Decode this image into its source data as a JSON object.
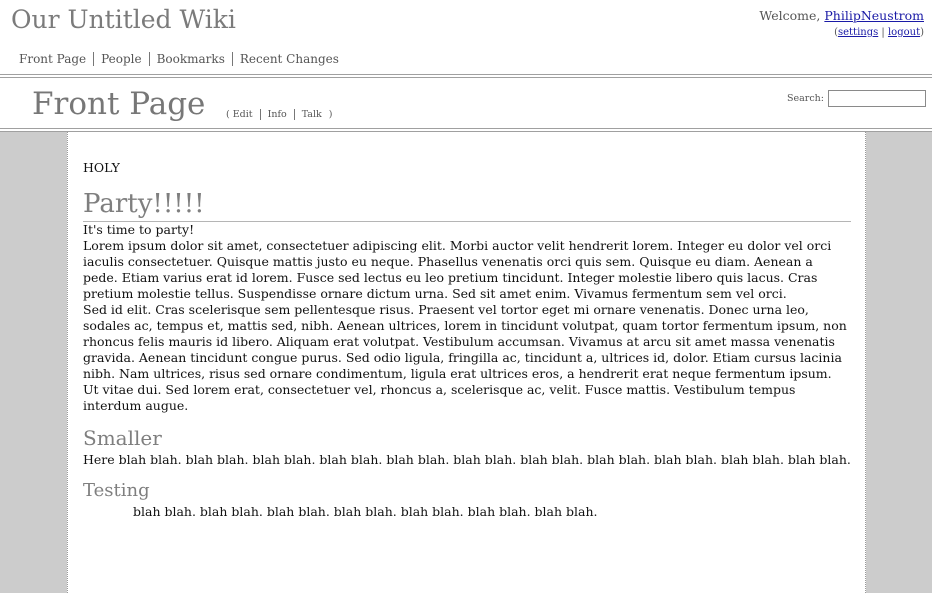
{
  "header": {
    "site_title": "Our Untitled Wiki",
    "nav": [
      "Front Page",
      "People",
      "Bookmarks",
      "Recent Changes"
    ],
    "welcome_prefix": "Welcome, ",
    "username": "PhilipNeustrom",
    "account_open": "(",
    "settings_label": "settings",
    "account_sep": " | ",
    "logout_label": "logout",
    "account_close": ")"
  },
  "page_header": {
    "title": "Front Page",
    "tabs_open": "(",
    "tabs": [
      "Edit",
      "Info",
      "Talk"
    ],
    "tabs_close": ")",
    "search_label": "Search:",
    "search_value": ""
  },
  "content": {
    "intro": "HOLY",
    "heading_party": "Party!!!!!",
    "party_text": "It's time to party!",
    "lorem1": "Lorem ipsum dolor sit amet, consectetuer adipiscing elit. Morbi auctor velit hendrerit lorem. Integer eu dolor vel orci iaculis consectetuer. Quisque mattis justo eu neque. Phasellus venenatis orci quis sem. Quisque eu diam. Aenean a pede. Etiam varius erat id lorem. Fusce sed lectus eu leo pretium tincidunt. Integer molestie libero quis lacus. Cras pretium molestie tellus. Suspendisse ornare dictum urna. Sed sit amet enim. Vivamus fermentum sem vel orci.",
    "lorem2": "Sed id elit. Cras scelerisque sem pellentesque risus. Praesent vel tortor eget mi ornare venenatis. Donec urna leo, sodales ac, tempus et, mattis sed, nibh. Aenean ultrices, lorem in tincidunt volutpat, quam tortor fermentum ipsum, non rhoncus felis mauris id libero. Aliquam erat volutpat. Vestibulum accumsan. Vivamus at arcu sit amet massa venenatis gravida. Aenean tincidunt congue purus. Sed odio ligula, fringilla ac, tincidunt a, ultrices id, dolor. Etiam cursus lacinia nibh. Nam ultrices, risus sed ornare condimentum, ligula erat ultrices eros, a hendrerit erat neque fermentum ipsum. Ut vitae dui. Sed lorem erat, consectetuer vel, rhoncus a, scelerisque ac, velit. Fusce mattis. Vestibulum tempus interdum augue.",
    "heading_smaller": "Smaller",
    "smaller_text": "Here blah blah. blah blah. blah blah. blah blah. blah blah. blah blah. blah blah. blah blah. blah blah. blah blah. blah blah.",
    "heading_testing": "Testing",
    "testing_text": "blah blah. blah blah. blah blah. blah blah. blah blah. blah blah. blah blah."
  },
  "colors": {
    "link": "#1a1aa6",
    "heading_gray": "#7f7f7f",
    "side_gutter": "#cccccc"
  }
}
